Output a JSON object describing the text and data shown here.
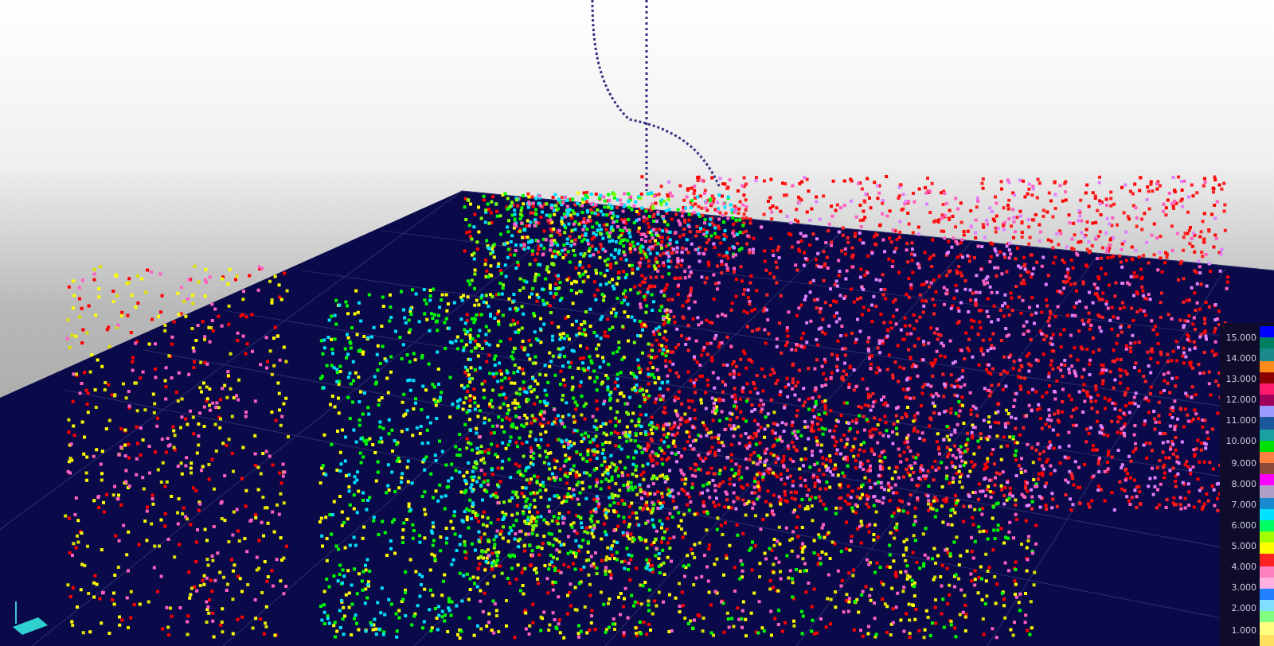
{
  "viewer": {
    "legend": {
      "labels": [
        "15.000",
        "14.000",
        "13.000",
        "12.000",
        "11.000",
        "10.000",
        "9.000",
        "8.000",
        "7.000",
        "6.000",
        "5.000",
        "4.000",
        "3.000",
        "2.000",
        "1.000"
      ],
      "swatches": [
        {
          "color": "#0000ff"
        },
        {
          "color": "#008060"
        },
        {
          "color": "#1a8a8a"
        },
        {
          "color": "#ff8c1a"
        },
        {
          "color": "#8b0000"
        },
        {
          "color": "#ff1a6e"
        },
        {
          "color": "#a0005a"
        },
        {
          "color": "#9a9aff"
        },
        {
          "color": "#1a5a9a"
        },
        {
          "color": "#1aa0a0"
        },
        {
          "color": "#00e000"
        },
        {
          "color": "#ff8040"
        },
        {
          "color": "#8b4a3a"
        },
        {
          "color": "#ff00ff"
        },
        {
          "color": "#b0a0c8"
        },
        {
          "color": "#1a8ad0"
        },
        {
          "color": "#00e0ff"
        },
        {
          "color": "#00ff60"
        },
        {
          "color": "#a0ff00"
        },
        {
          "color": "#ffff00"
        },
        {
          "color": "#ff2020"
        },
        {
          "color": "#ff80c0"
        },
        {
          "color": "#ffb0e0"
        },
        {
          "color": "#2080ff"
        },
        {
          "color": "#80e0ff"
        },
        {
          "color": "#80ff80"
        },
        {
          "color": "#ffff80"
        },
        {
          "color": "#ffe060"
        }
      ]
    }
  }
}
